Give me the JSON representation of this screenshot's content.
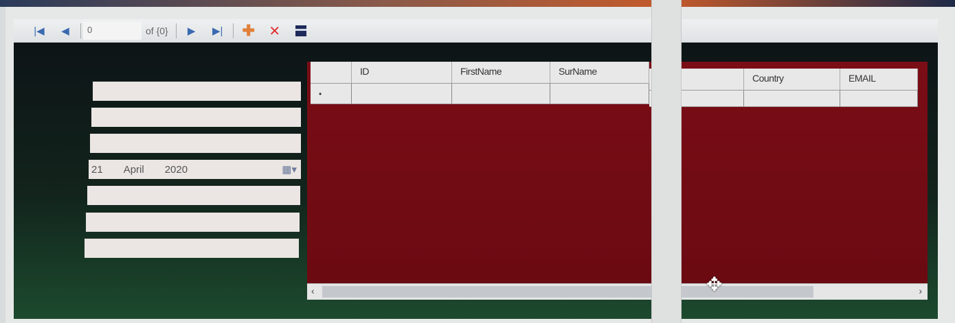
{
  "navigator": {
    "position": "0",
    "count_label": "of {0}",
    "icons": [
      "move-first-icon",
      "move-previous-icon",
      "move-next-icon",
      "move-last-icon",
      "add-new-icon",
      "delete-icon",
      "save-icon"
    ]
  },
  "form": {
    "date_field": {
      "day": "21",
      "month": "April",
      "year": "2020"
    }
  },
  "grid": {
    "columns": [
      "",
      "ID",
      "FirstName",
      "SurName",
      "",
      "Country",
      "EMAIL"
    ],
    "new_row_marker": "•"
  },
  "colors": {
    "grid_background": "#7a0d16",
    "form_background": "#12241c",
    "add_icon": "#e0803a",
    "delete_icon": "#e03030",
    "nav_icon": "#3a6ab0"
  }
}
